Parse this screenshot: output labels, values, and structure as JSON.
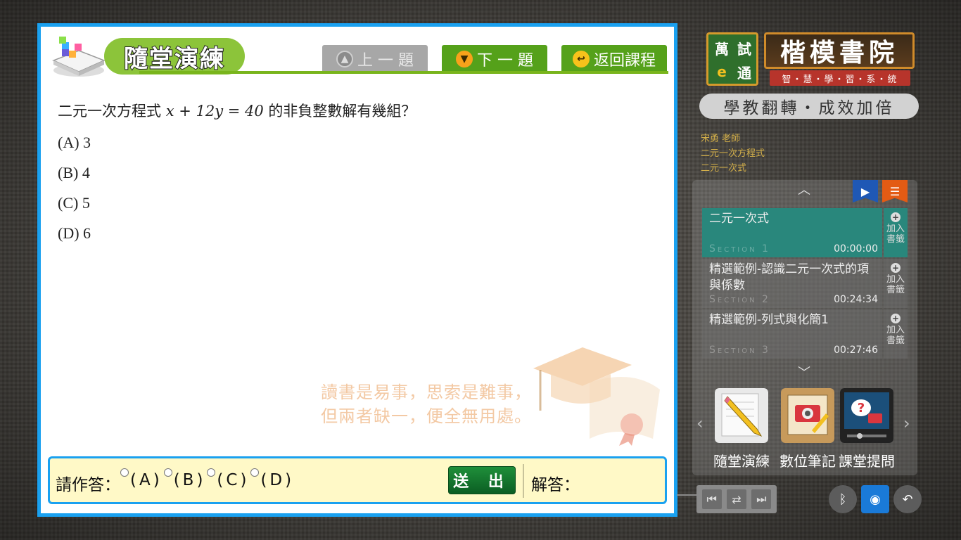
{
  "exercise": {
    "title": "隨堂演練",
    "prev_label": "上 一 題",
    "next_label": "下 一 題",
    "back_label": "返回課程",
    "question_prefix": "二元一次方程式",
    "question_math": "x + 12y = 40",
    "question_suffix": "的非負整數解有幾組？",
    "options": [
      "(A) 3",
      "(B) 4",
      "(C) 5",
      "(D) 6"
    ],
    "quote_line1": "讀書是易事，思索是難事，",
    "quote_line2": "但兩者缺一，便全無用處。",
    "answer_prompt": "請作答：",
    "choices": [
      "(A)",
      "(B)",
      "(C)",
      "(D)"
    ],
    "submit_label": "送 出",
    "solution_label": "解答："
  },
  "brand": {
    "badge_chars": [
      "萬",
      "試",
      "e",
      "通"
    ],
    "name": "楷模書院",
    "subtitle": "智・慧・學・習・系・統",
    "slogan": "學教翻轉・成效加倍"
  },
  "course": {
    "teacher": "宋勇  老師",
    "chapter": "二元一次方程式",
    "unit": "二元一次式"
  },
  "sections": [
    {
      "title": "二元一次式",
      "section": "Section 1",
      "time": "00:00:00",
      "bookmark": "加入書籤",
      "active": true
    },
    {
      "title": "精選範例-認識二元一次式的項與係數",
      "section": "Section 2",
      "time": "00:24:34",
      "bookmark": "加入書籤",
      "active": false
    },
    {
      "title": "精選範例-列式與化簡1",
      "section": "Section 3",
      "time": "00:27:46",
      "bookmark": "加入書籤",
      "active": false
    }
  ],
  "tools": [
    {
      "label": "隨堂演練",
      "icon": "pencil-notebook-icon"
    },
    {
      "label": "數位筆記",
      "icon": "notebook-camera-icon"
    },
    {
      "label": "課堂提問",
      "icon": "question-screen-icon"
    }
  ],
  "colors": {
    "frame_blue": "#1aa1f0",
    "header_green": "#55a11a",
    "active_section": "#29877c",
    "answer_bg": "#fff9c7"
  }
}
